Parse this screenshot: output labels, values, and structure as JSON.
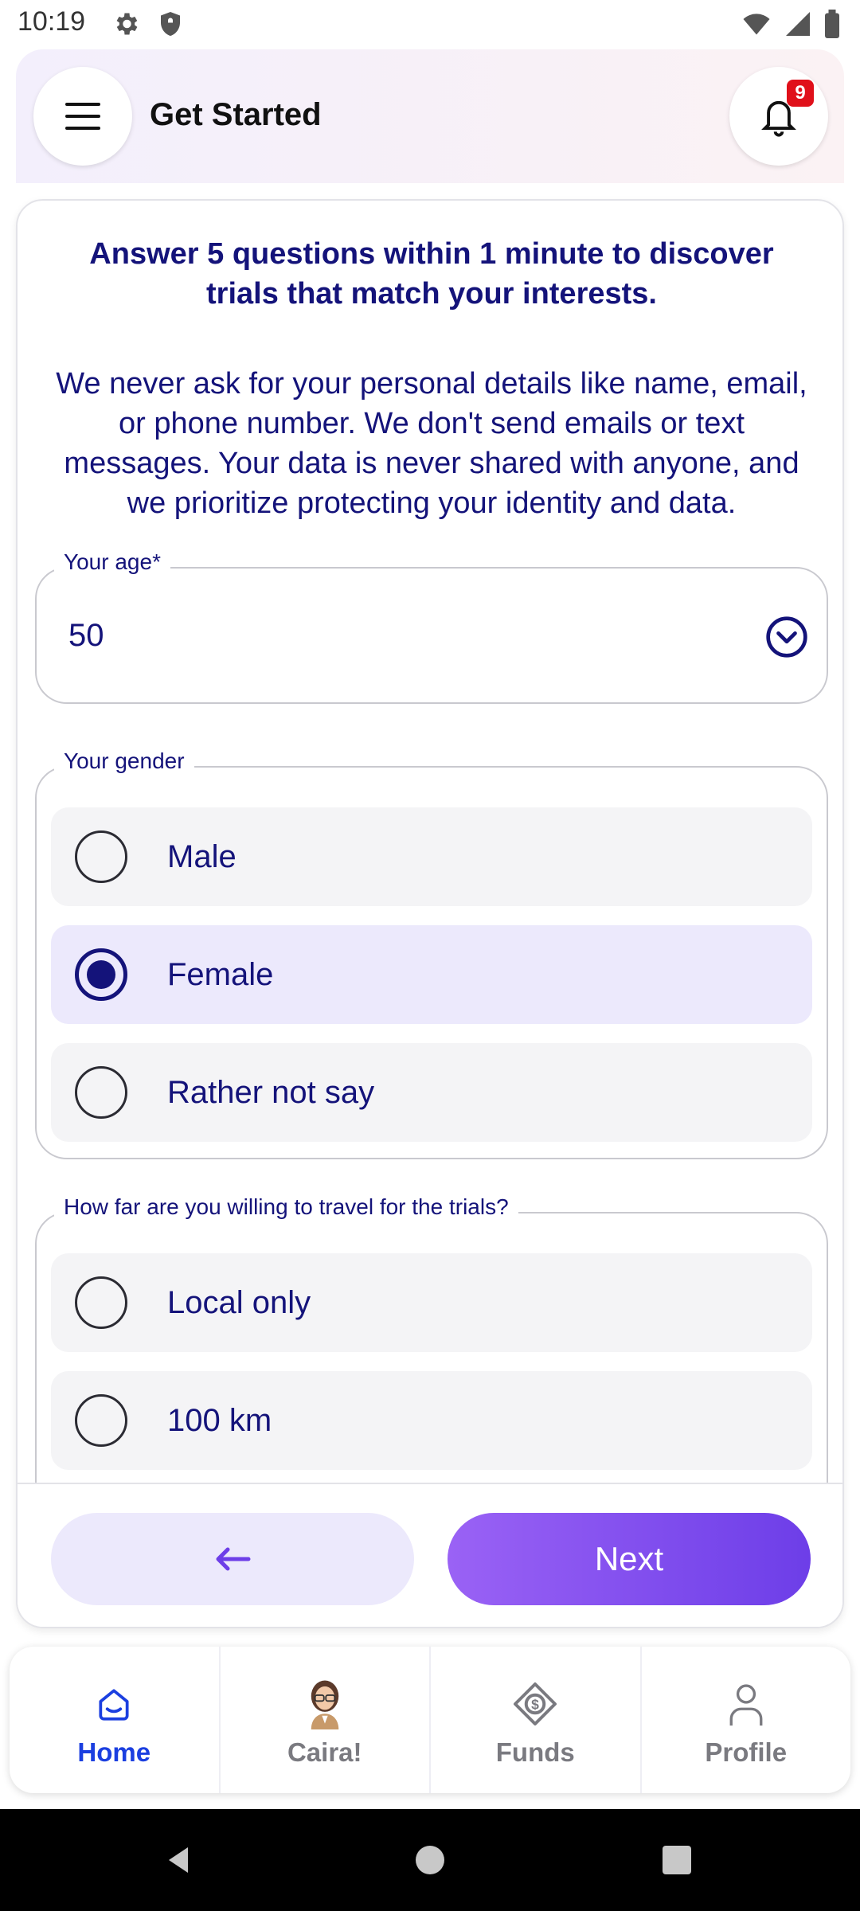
{
  "status_bar": {
    "time": "10:19",
    "left_icons": [
      "gear-icon",
      "shield-icon"
    ],
    "right_icons": [
      "wifi-icon",
      "signal-icon",
      "battery-icon"
    ]
  },
  "header": {
    "title": "Get Started",
    "notification_count": "9"
  },
  "intro": {
    "title": "Answer 5 questions within 1 minute to discover trials that match your interests.",
    "text": "We never ask for your personal details like name, email, or phone number. We don't send emails or text messages. Your data is never shared with anyone, and we prioritize protecting your identity and data."
  },
  "age_field": {
    "label": "Your age*",
    "value": "50"
  },
  "gender_field": {
    "label": "Your gender",
    "options": [
      {
        "label": "Male",
        "selected": false
      },
      {
        "label": "Female",
        "selected": true
      },
      {
        "label": "Rather not say",
        "selected": false
      }
    ]
  },
  "travel_field": {
    "label": "How far are you willing to travel for the trials?",
    "options": [
      {
        "label": "Local only",
        "selected": false
      },
      {
        "label": "100 km",
        "selected": false
      }
    ]
  },
  "footer": {
    "back_icon": "arrow-left-icon",
    "next_label": "Next"
  },
  "bottom_nav": {
    "items": [
      {
        "label": "Home",
        "icon": "home-icon",
        "active": true
      },
      {
        "label": "Caira!",
        "icon": "avatar-icon",
        "active": false
      },
      {
        "label": "Funds",
        "icon": "funds-icon",
        "active": false
      },
      {
        "label": "Profile",
        "icon": "profile-icon",
        "active": false
      }
    ]
  },
  "colors": {
    "primary_text": "#14137a",
    "accent_purple": "#7c4dee",
    "active_nav": "#1b3fe0",
    "badge_red": "#e0101a"
  }
}
